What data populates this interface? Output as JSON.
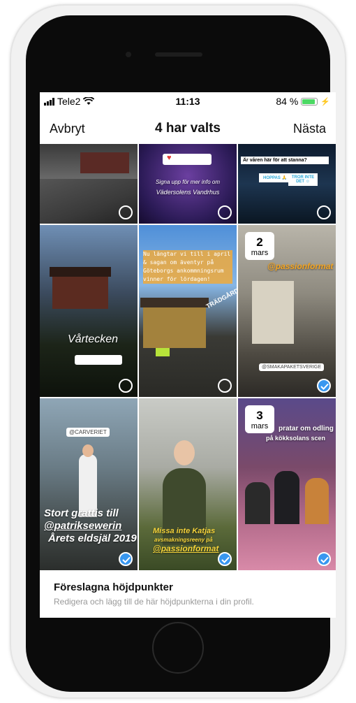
{
  "status": {
    "carrier": "Tele2",
    "time": "11:13",
    "battery_text": "84 %",
    "battery_level": 0.84
  },
  "nav": {
    "cancel": "Avbryt",
    "title": "4 har valts",
    "next": "Nästa"
  },
  "stories": [
    {
      "selected": false,
      "texts": []
    },
    {
      "selected": false,
      "texts": [
        "Signa upp för mer info om",
        "Vädersolens Vandrhus"
      ]
    },
    {
      "selected": false,
      "texts": [
        "Är våren här för att stanna?",
        "HOPPAS 🙏",
        "TROR INTE DET ☺"
      ]
    },
    {
      "selected": false,
      "texts": [
        "Vårtecken"
      ]
    },
    {
      "selected": false,
      "texts": [
        "Nu längtar vi till i april & sagan om äventyr på Göteborgs ankommningsrum vinner för lördagen!",
        "TRÄDGÅRD"
      ]
    },
    {
      "selected": true,
      "date_day": "2",
      "date_month": "mars",
      "texts": [
        "@passionformat",
        "@SMAKAPAKETSVERIGE"
      ]
    },
    {
      "selected": true,
      "texts": [
        "@CARVERIET",
        "Stort grattis till",
        "@patriksewerin",
        "Årets eldsjäl 2019"
      ]
    },
    {
      "selected": true,
      "texts": [
        "Missa inte Katjas",
        "avsmakningsreeny på",
        "@passionformat"
      ]
    },
    {
      "selected": true,
      "date_day": "3",
      "date_month": "mars",
      "texts": [
        "pratar om odling",
        "på kökksolans scen"
      ]
    }
  ],
  "footer": {
    "title": "Föreslagna höjdpunkter",
    "subtitle": "Redigera och lägg till de här höjdpunkterna i din profil."
  },
  "colors": {
    "selected": "#3897f0",
    "battery": "#4cd964"
  }
}
